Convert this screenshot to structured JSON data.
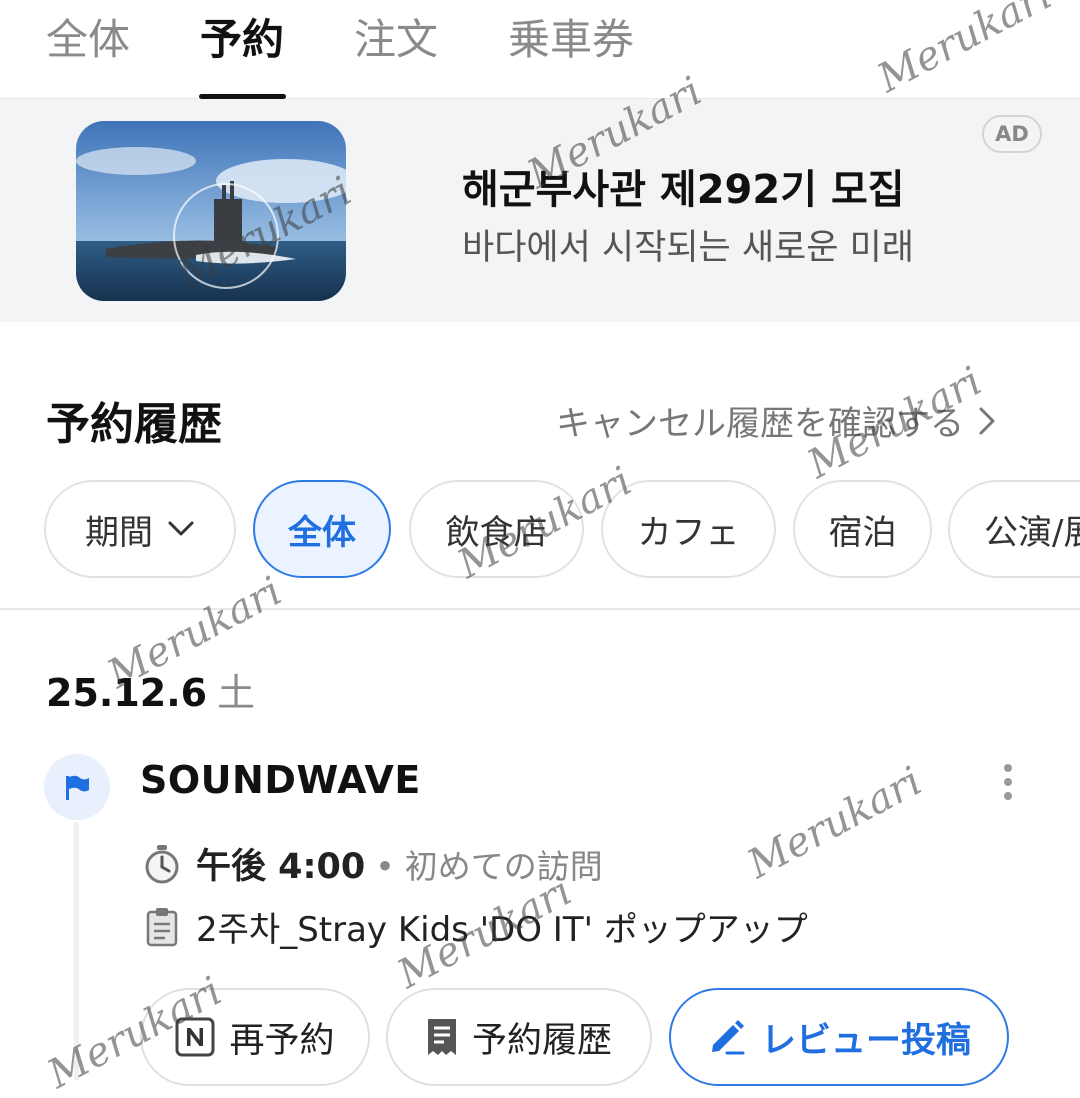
{
  "tabs": [
    {
      "label": "全体"
    },
    {
      "label": "予約"
    },
    {
      "label": "注文"
    },
    {
      "label": "乗車券"
    }
  ],
  "ad": {
    "title": "해군부사관 제292기 모집",
    "subtitle": "바다에서 시작되는 새로운 미래",
    "badge": "AD"
  },
  "history": {
    "title": "予約履歴",
    "cancel_link": "キャンセル履歴を確認する"
  },
  "filters": [
    {
      "label": "期間"
    },
    {
      "label": "全体"
    },
    {
      "label": "飲食店"
    },
    {
      "label": "カフェ"
    },
    {
      "label": "宿泊"
    },
    {
      "label": "公演/展"
    }
  ],
  "date": {
    "value": "25.12.6",
    "day": "土"
  },
  "booking": {
    "place": "SOUNDWAVE",
    "time": "午後 4:00",
    "visit": "初めての訪問",
    "event": "2주차_Stray Kids 'DO IT' ポップアップ",
    "actions": {
      "rebook": "再予約",
      "history": "予約履歴",
      "review": "レビュー投稿"
    }
  },
  "watermark": "Merukari",
  "colors": {
    "accent": "#1f6fe0",
    "active_chip_bg": "#eaf3ff",
    "ad_bg": "#f2f4f6"
  }
}
